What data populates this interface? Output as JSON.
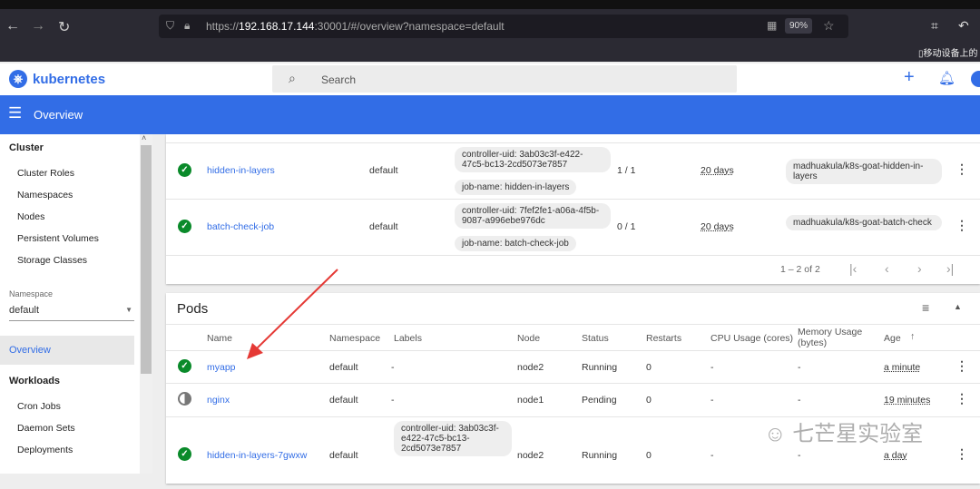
{
  "browser": {
    "url_prefix": "https://",
    "url_host": "192.168.17.144",
    "url_rest": ":30001/#/overview?namespace=default",
    "zoom": "90%",
    "bookmark": "移动设备上的"
  },
  "app": {
    "name": "kubernetes",
    "search_placeholder": "Search",
    "page_title": "Overview"
  },
  "sidebar": {
    "cluster_heading": "Cluster",
    "cluster_items": [
      "Cluster Roles",
      "Namespaces",
      "Nodes",
      "Persistent Volumes",
      "Storage Classes"
    ],
    "namespace_label": "Namespace",
    "namespace_value": "default",
    "overview": "Overview",
    "workloads_heading": "Workloads",
    "workload_items": [
      "Cron Jobs",
      "Daemon Sets",
      "Deployments"
    ]
  },
  "jobs": {
    "rows": [
      {
        "name": "hidden-in-layers",
        "namespace": "default",
        "labels": [
          "controller-uid: 3ab03c3f-e422-47c5-bc13-2cd5073e7857",
          "job-name: hidden-in-layers"
        ],
        "pods": "1 / 1",
        "age": "20 days",
        "image": "madhuakula/k8s-goat-hidden-in-layers"
      },
      {
        "name": "batch-check-job",
        "namespace": "default",
        "labels": [
          "controller-uid: 7fef2fe1-a06a-4f5b-9087-a996ebe976dc",
          "job-name: batch-check-job"
        ],
        "pods": "0 / 1",
        "age": "20 days",
        "image": "madhuakula/k8s-goat-batch-check"
      }
    ],
    "pagination": "1 – 2 of 2"
  },
  "pods": {
    "title": "Pods",
    "headers": [
      "Name",
      "Namespace",
      "Labels",
      "Node",
      "Status",
      "Restarts",
      "CPU Usage (cores)",
      "Memory Usage (bytes)",
      "Age"
    ],
    "rows": [
      {
        "name": "myapp",
        "namespace": "default",
        "labels": "-",
        "node": "node2",
        "status": "Running",
        "restarts": "0",
        "cpu": "-",
        "mem": "-",
        "age": "a minute"
      },
      {
        "name": "nginx",
        "namespace": "default",
        "labels": "-",
        "node": "node1",
        "status": "Pending",
        "restarts": "0",
        "cpu": "-",
        "mem": "-",
        "age": "19 minutes"
      },
      {
        "name": "hidden-in-layers-7gwxw",
        "namespace": "default",
        "labels": "controller-uid: 3ab03c3f-e422-47c5-bc13-2cd5073e7857",
        "node": "node2",
        "status": "Running",
        "restarts": "0",
        "cpu": "-",
        "mem": "-",
        "age": "a day"
      }
    ]
  },
  "watermark": "七芒星实验室"
}
